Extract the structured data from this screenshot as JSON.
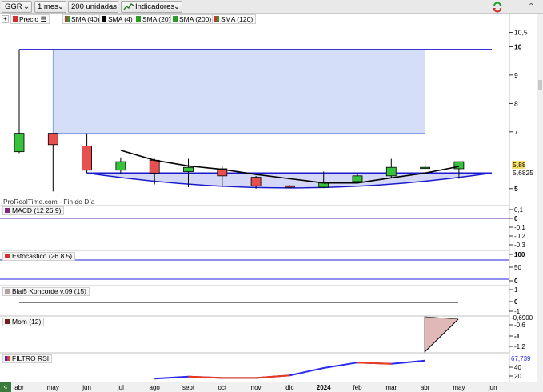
{
  "toolbar": {
    "symbol": "GGR",
    "period": "1 mes",
    "units": "200 unidades",
    "indicators": "Indicadores"
  },
  "legend": {
    "price": "Precio",
    "sma40": "SMA (40)",
    "sma4": "SMA (4)",
    "sma20": "SMA (20)",
    "sma200": "SMA (200)",
    "sma120": "SMA (120)"
  },
  "colors": {
    "up": "#36c23a",
    "down": "#e85050",
    "trend": "#1a1acc",
    "zone": "#d4def8",
    "sma4": "#000000",
    "rsi_up": "#2a2aee",
    "rsi_down": "#ee3a1a"
  },
  "watermark": "ProRealTime.com - Fin de Día",
  "main_axis": {
    "ticks": [
      {
        "v": 10.5,
        "t": "10,5",
        "bold": false
      },
      {
        "v": 10,
        "t": "10",
        "bold": true
      },
      {
        "v": 9,
        "t": "9",
        "bold": false
      },
      {
        "v": 8,
        "t": "8",
        "bold": false
      },
      {
        "v": 7,
        "t": "7",
        "bold": false
      },
      {
        "v": 5,
        "t": "5",
        "bold": true
      }
    ],
    "last_price": "5,88",
    "sma_value": "5,6825"
  },
  "x_labels": [
    "abr",
    "may",
    "jun",
    "jul",
    "ago",
    "sept",
    "oct",
    "nov",
    "dic",
    "2024",
    "feb",
    "mar",
    "abr",
    "may",
    "jun"
  ],
  "chart_data": {
    "type": "candlestick",
    "categories": [
      "abr",
      "may",
      "jun",
      "jul",
      "ago",
      "sept",
      "oct",
      "nov",
      "dic",
      "2024",
      "feb",
      "mar",
      "abr",
      "may"
    ],
    "candles": [
      {
        "o": 6.3,
        "h": 9.9,
        "l": 6.25,
        "c": 6.95
      },
      {
        "o": 6.95,
        "h": 6.95,
        "l": 4.9,
        "c": 6.55
      },
      {
        "o": 6.5,
        "h": 6.95,
        "l": 5.55,
        "c": 5.65
      },
      {
        "o": 5.65,
        "h": 6.1,
        "l": 5.5,
        "c": 5.95
      },
      {
        "o": 6.0,
        "h": 6.05,
        "l": 5.15,
        "c": 5.55
      },
      {
        "o": 5.6,
        "h": 6.05,
        "l": 5.05,
        "c": 5.75
      },
      {
        "o": 5.7,
        "h": 5.8,
        "l": 5.05,
        "c": 5.45
      },
      {
        "o": 5.4,
        "h": 5.45,
        "l": 5.0,
        "c": 5.1
      },
      {
        "o": 5.1,
        "h": 5.12,
        "l": 5.02,
        "c": 5.05
      },
      {
        "o": 5.05,
        "h": 5.6,
        "l": 5.02,
        "c": 5.2
      },
      {
        "o": 5.25,
        "h": 5.55,
        "l": 5.2,
        "c": 5.45
      },
      {
        "o": 5.45,
        "h": 6.05,
        "l": 5.4,
        "c": 5.75
      },
      {
        "o": 5.75,
        "h": 6.0,
        "l": 5.7,
        "c": 5.75
      },
      {
        "o": 5.7,
        "h": 5.95,
        "l": 5.35,
        "c": 5.95
      }
    ],
    "sma4": [
      null,
      null,
      null,
      6.35,
      6.0,
      5.8,
      5.68,
      5.5,
      5.35,
      5.2,
      5.2,
      5.38,
      5.55,
      5.78
    ],
    "ylim": [
      4.6,
      10.8
    ],
    "resistance": 9.9,
    "zone": {
      "from": 1,
      "to": 12,
      "low": 6.95,
      "high": 9.9
    }
  },
  "indicators": {
    "macd": {
      "label": "MACD (12 26 9)",
      "ticks": [
        "0,1",
        "0",
        "-0,1",
        "-0,2",
        "-0,3"
      ]
    },
    "stoch": {
      "label": "Estocástico (26 8 5)",
      "ticks": [
        "100",
        "50",
        "0"
      ]
    },
    "blai": {
      "label": "Blai5 Koncorde v.09 (15)",
      "ticks": [
        "1",
        "0",
        "-1"
      ]
    },
    "mom": {
      "label": "Mom (12)",
      "ticks": [
        "-0,6",
        "-1",
        "-1,2"
      ],
      "value": "-0,6900"
    },
    "rsi": {
      "label": "FILTRO RSI",
      "ticks": [
        "40",
        "20"
      ],
      "value": "67,739",
      "values": [
        12,
        18,
        14,
        14,
        22,
        45,
        62,
        58,
        68
      ]
    }
  }
}
